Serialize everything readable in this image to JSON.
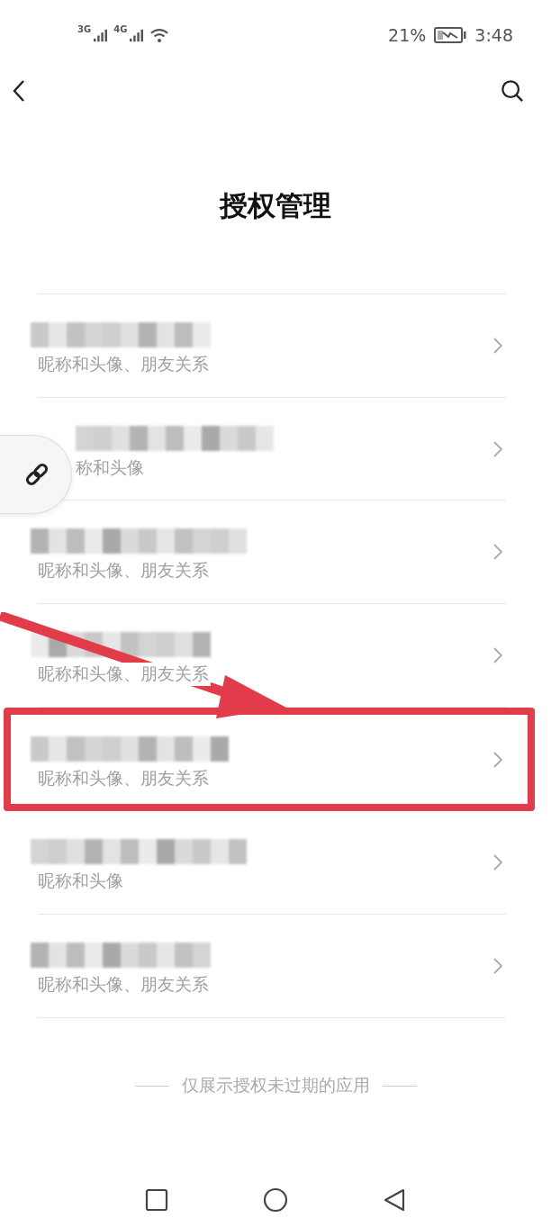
{
  "status_bar": {
    "network_1": "3G",
    "network_2": "4G",
    "battery_percent": "21%",
    "time": "3:48"
  },
  "header": {
    "title": "授权管理"
  },
  "apps": [
    {
      "subtitle": "昵称和头像、朋友关系",
      "highlighted": false
    },
    {
      "subtitle": "称和头像",
      "highlighted": false
    },
    {
      "subtitle": "昵称和头像、朋友关系",
      "highlighted": false
    },
    {
      "subtitle": "昵称和头像、朋友关系",
      "highlighted": false
    },
    {
      "subtitle": "昵称和头像、朋友关系",
      "highlighted": true
    },
    {
      "subtitle": "昵称和头像",
      "highlighted": false
    },
    {
      "subtitle": "昵称和头像、朋友关系",
      "highlighted": false
    }
  ],
  "footer_note": "仅展示授权未过期的应用"
}
